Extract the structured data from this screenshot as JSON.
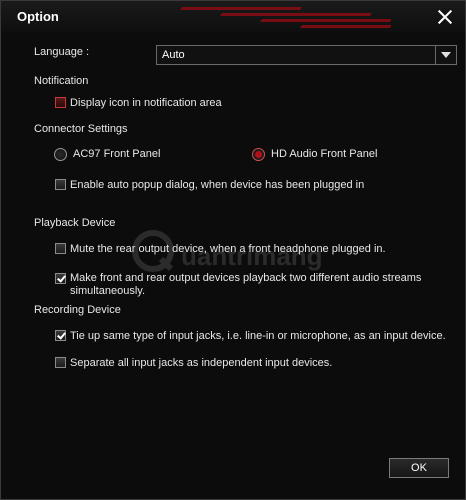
{
  "window": {
    "title": "Option"
  },
  "language": {
    "label": "Language :",
    "value": "Auto"
  },
  "notification": {
    "heading": "Notification",
    "display_icon": {
      "label": "Display icon in notification area",
      "checked": false
    }
  },
  "connector": {
    "heading": "Connector Settings",
    "ac97": {
      "label": "AC97 Front Panel",
      "selected": false
    },
    "hd_audio": {
      "label": "HD Audio Front Panel",
      "selected": true
    },
    "auto_popup": {
      "label": "Enable auto popup dialog, when device has been plugged in",
      "checked": false
    }
  },
  "playback": {
    "heading": "Playback Device",
    "mute_rear": {
      "label": "Mute the rear output device, when a front headphone plugged in.",
      "checked": false
    },
    "make_front_rear": {
      "label_line1": "Make front and rear output devices playback two different audio streams",
      "label_line2": "simultaneously.",
      "checked": true
    }
  },
  "recording": {
    "heading": "Recording Device",
    "tie_up": {
      "label": "Tie up same type of input jacks, i.e. line-in or microphone, as an input device.",
      "checked": true
    },
    "separate": {
      "label": "Separate all input jacks as independent input devices.",
      "checked": false
    }
  },
  "buttons": {
    "ok": "OK"
  },
  "watermark": {
    "text": "uantrimang"
  },
  "colors": {
    "accent": "#b0101a",
    "background": "#0c0c0c",
    "text": "#e8e8e8"
  },
  "icons": {
    "close": "close-icon",
    "dropdown": "chevron-down-icon"
  }
}
